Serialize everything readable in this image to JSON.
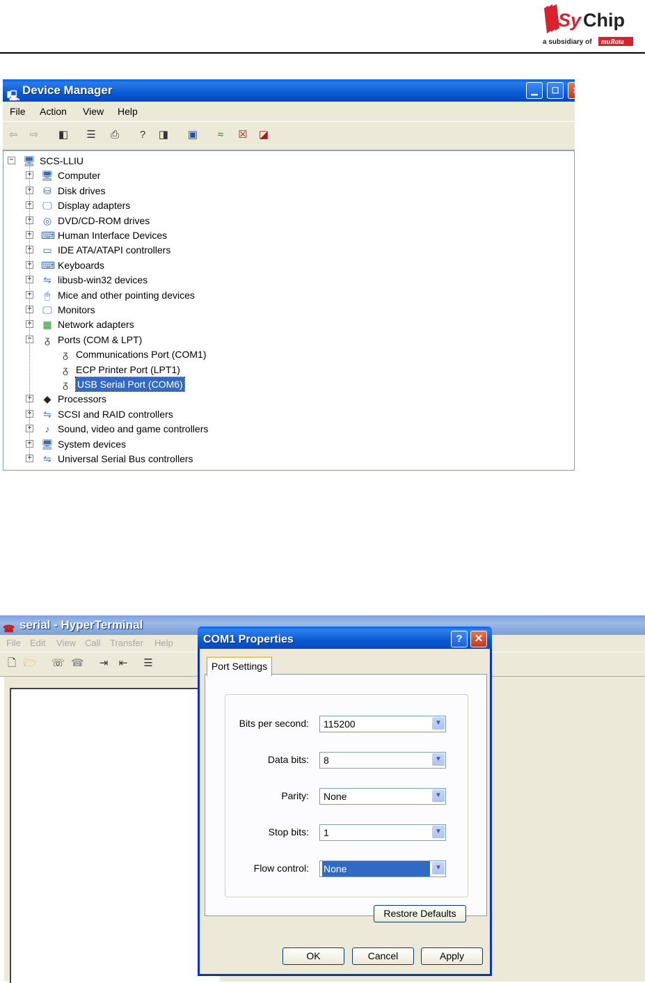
{
  "logo": {
    "brand": "SyChip",
    "tagline": "a subsidiary of",
    "parent": "muRata",
    "brand_color": "#d8202f"
  },
  "device_manager": {
    "title": "Device Manager",
    "menu": [
      "File",
      "Action",
      "View",
      "Help"
    ],
    "root": "SCS-LLIU",
    "categories": [
      {
        "label": "Computer",
        "icon": "computer-icon"
      },
      {
        "label": "Disk drives",
        "icon": "disk-icon"
      },
      {
        "label": "Display adapters",
        "icon": "monitor-icon"
      },
      {
        "label": "DVD/CD-ROM drives",
        "icon": "cd-icon"
      },
      {
        "label": "Human Interface Devices",
        "icon": "hid-icon"
      },
      {
        "label": "IDE ATA/ATAPI controllers",
        "icon": "ide-icon"
      },
      {
        "label": "Keyboards",
        "icon": "keyboard-icon"
      },
      {
        "label": "libusb-win32 devices",
        "icon": "usb-icon"
      },
      {
        "label": "Mice and other pointing devices",
        "icon": "mouse-icon"
      },
      {
        "label": "Monitors",
        "icon": "monitor-icon"
      },
      {
        "label": "Network adapters",
        "icon": "network-icon"
      },
      {
        "label": "Ports (COM & LPT)",
        "icon": "port-icon",
        "expanded": true,
        "children": [
          "Communications Port (COM1)",
          "ECP Printer Port (LPT1)",
          "USB Serial Port (COM6)"
        ],
        "selected_child": "USB Serial Port (COM6)"
      },
      {
        "label": "Processors",
        "icon": "processor-icon"
      },
      {
        "label": "SCSI and RAID controllers",
        "icon": "scsi-icon"
      },
      {
        "label": "Sound, video and game controllers",
        "icon": "sound-icon"
      },
      {
        "label": "System devices",
        "icon": "system-icon"
      },
      {
        "label": "Universal Serial Bus controllers",
        "icon": "usb-icon"
      }
    ]
  },
  "hyperterminal": {
    "title": "serial - HyperTerminal",
    "menu": [
      "File",
      "Edit",
      "View",
      "Call",
      "Transfer",
      "Help"
    ]
  },
  "com_dialog": {
    "title": "COM1 Properties",
    "help_glyph": "?",
    "close_glyph": "✕",
    "tab": "Port Settings",
    "fields": [
      {
        "label": "Bits per second:",
        "value": "115200"
      },
      {
        "label": "Data bits:",
        "value": "8"
      },
      {
        "label": "Parity:",
        "value": "None"
      },
      {
        "label": "Stop bits:",
        "value": "1"
      },
      {
        "label": "Flow control:",
        "value": "None",
        "highlighted": true
      }
    ],
    "restore_defaults": "Restore Defaults",
    "ok": "OK",
    "cancel": "Cancel",
    "apply": "Apply"
  }
}
